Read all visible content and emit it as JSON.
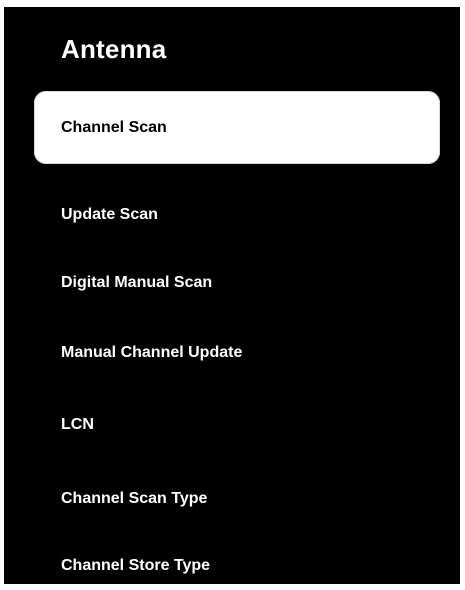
{
  "menu": {
    "title": "Antenna",
    "items": [
      {
        "label": "Channel Scan",
        "selected": true
      },
      {
        "label": "Update Scan",
        "selected": false
      },
      {
        "label": "Digital Manual Scan",
        "selected": false
      },
      {
        "label": "Manual Channel Update",
        "selected": false
      },
      {
        "label": "LCN",
        "selected": false
      },
      {
        "label": "Channel Scan Type",
        "selected": false
      },
      {
        "label": "Channel Store Type",
        "selected": false
      }
    ]
  },
  "colors": {
    "background": "#000000",
    "text": "#ffffff",
    "selected_background": "#ffffff",
    "selected_text": "#000000"
  }
}
